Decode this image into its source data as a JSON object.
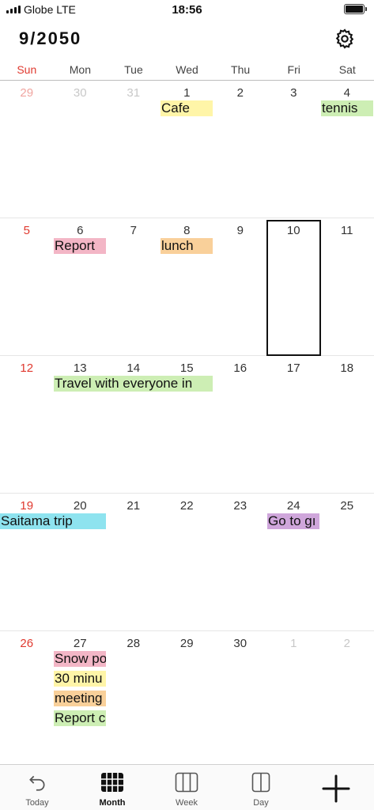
{
  "status_bar": {
    "carrier": "Globe  LTE",
    "time": "18:56"
  },
  "header": {
    "title": "9/2050",
    "settings_icon": "gear-icon"
  },
  "weekdays": [
    "Sun",
    "Mon",
    "Tue",
    "Wed",
    "Thu",
    "Fri",
    "Sat"
  ],
  "weeks": [
    {
      "days": [
        "29",
        "30",
        "31",
        "1",
        "2",
        "3",
        "4"
      ],
      "events": [
        {
          "label": "Cafe",
          "color": "#fff5a8"
        },
        {
          "label": "tennis",
          "color": "#cdeeb4"
        }
      ]
    },
    {
      "days": [
        "5",
        "6",
        "7",
        "8",
        "9",
        "10",
        "11"
      ],
      "events": [
        {
          "label": "Report",
          "color": "#f3b6c6"
        },
        {
          "label": "lunch",
          "color": "#f9d09a"
        }
      ]
    },
    {
      "days": [
        "12",
        "13",
        "14",
        "15",
        "16",
        "17",
        "18"
      ],
      "events": [
        {
          "label": "Travel with everyone in",
          "color": "#cdeeb4"
        }
      ]
    },
    {
      "days": [
        "19",
        "20",
        "21",
        "22",
        "23",
        "24",
        "25"
      ],
      "events": [
        {
          "label": "Saitama trip",
          "color": "#8ee3ef"
        },
        {
          "label": "Go to gı",
          "color": "#cfa6db"
        }
      ]
    },
    {
      "days": [
        "26",
        "27",
        "28",
        "29",
        "30",
        "1",
        "2"
      ],
      "events": [
        {
          "label": "Snow po",
          "color": "#f3b6c6"
        },
        {
          "label": "30 minu",
          "color": "#fff5a8"
        },
        {
          "label": "meeting",
          "color": "#f9d09a"
        },
        {
          "label": "Report c",
          "color": "#cdeeb4"
        }
      ]
    }
  ],
  "tabs": [
    {
      "label": "Today",
      "icon": "undo-icon"
    },
    {
      "label": "Month",
      "icon": "month-grid-icon"
    },
    {
      "label": "Week",
      "icon": "week-columns-icon"
    },
    {
      "label": "Day",
      "icon": "day-columns-icon"
    }
  ],
  "add_icon": "plus-icon"
}
